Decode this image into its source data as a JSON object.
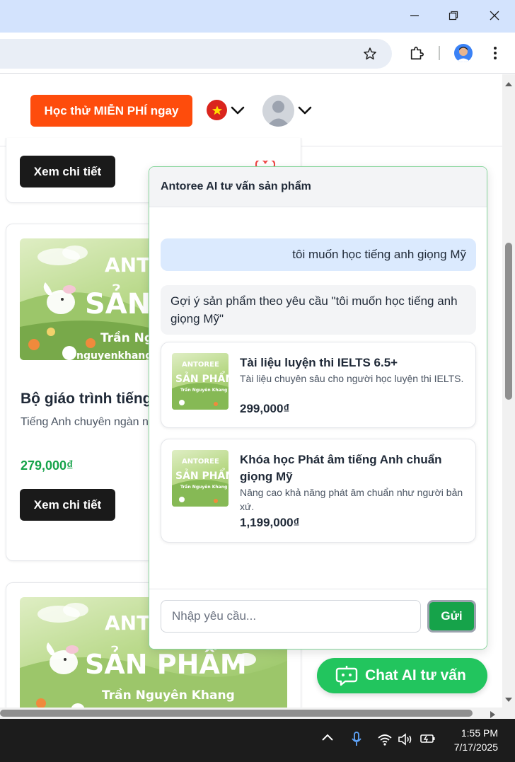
{
  "header": {
    "trial_button": "Học thử MIỄN PHÍ ngay"
  },
  "cards": {
    "top_button": "Xem chi tiết",
    "item2": {
      "title": "Bộ giáo trình tiếng",
      "desc": "Tiếng Anh chuyên ngàn nghiệp.",
      "price": "279,000₫",
      "button": "Xem chi tiết"
    },
    "image_text": {
      "line1": "ANTO",
      "line2": "SẢN",
      "line3": "Trần Nguyễ",
      "line4": "nguyenkhang",
      "b_line1": "ANT",
      "b_line2": "SẢN PHẨM",
      "b_line3": "Trần Nguyên Khang"
    }
  },
  "chat": {
    "title": "Antoree AI tư vấn sản phẩm",
    "user_message": "tôi muốn học tiếng anh giọng Mỹ",
    "ai_message": "Gợi ý sản phẩm theo yêu cầu \"tôi muốn học tiếng anh giọng Mỹ\"",
    "products": [
      {
        "name": "Tài liệu luyện thi IELTS 6.5+",
        "desc": "Tài liệu chuyên sâu cho người học luyện thi IELTS.",
        "price": "299,000₫"
      },
      {
        "name": "Khóa học Phát âm tiếng Anh chuẩn giọng Mỹ",
        "desc": "Nâng cao khả năng phát âm chuẩn như người bản xứ.",
        "price": "1,199,000₫"
      }
    ],
    "thumb_text": {
      "line1": "ANTOREE",
      "line2": "SẢN PHẨM",
      "line3": "Trần Nguyên Khang"
    },
    "input_placeholder": "Nhập yêu cầu...",
    "send_label": "Gửi"
  },
  "fab": {
    "label": "Chat AI tư vấn"
  },
  "taskbar": {
    "time": "1:55 PM",
    "date": "7/17/2025"
  },
  "colors": {
    "trial_orange": "#fe4c0c",
    "price_green": "#16a34a",
    "fab_green": "#22c55e",
    "user_bubble": "#dbeafe",
    "chrome_blue": "#d3e3fd"
  },
  "icons": {
    "window": [
      "minimize-icon",
      "restore-icon",
      "close-icon"
    ],
    "toolbar": [
      "bookmark-star-icon",
      "extensions-icon",
      "profile-avatar",
      "more-menu-icon"
    ],
    "tray": [
      "chevron-up-icon",
      "microphone-icon",
      "wifi-icon",
      "speaker-icon",
      "battery-icon"
    ]
  }
}
